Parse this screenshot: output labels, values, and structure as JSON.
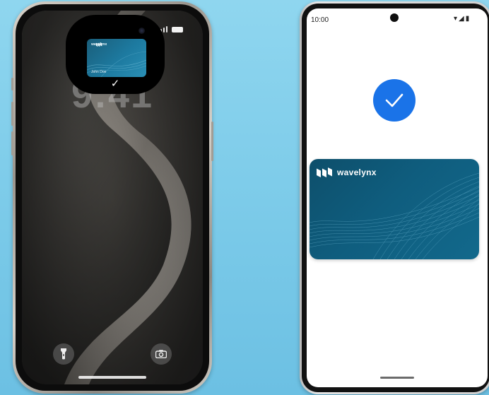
{
  "iphone": {
    "lock_time": "9:41",
    "island": {
      "card_brand": "wavelynx",
      "card_holder": "John Doe",
      "check_glyph": "✓",
      "check_icon": "checkmark-icon"
    },
    "buttons": [
      {
        "name": "flashlight",
        "icon": "flashlight-icon"
      },
      {
        "name": "camera",
        "icon": "camera-icon"
      }
    ]
  },
  "android": {
    "status": {
      "time": "10:00",
      "wifi_glyph": "▾",
      "signal_glyph": "◢",
      "battery_glyph": "▮"
    },
    "success_icon": "checkmark-circle-icon",
    "card": {
      "brand": "wavelynx",
      "logo_icon": "wavelynx-logo-icon"
    }
  },
  "colors": {
    "background": "#79c9e8",
    "success_blue": "#1a73e8",
    "card_teal": "#0f5d7e"
  }
}
